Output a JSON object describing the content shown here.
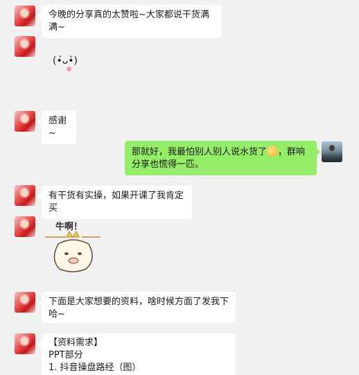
{
  "messages": {
    "m1": {
      "text": "今晚的分享真的太赞啦~大家都说干货满满~"
    },
    "m2": {
      "kaomoji": "(•́ᴗ•̀)"
    },
    "m3": {
      "text": "感谢~"
    },
    "m4": {
      "text_before": "那就好，我最怕别人别人说水货了",
      "text_after": "，群响分享也慌得一匹。",
      "emoji_icon": "laughing-face-emoji"
    },
    "m5": {
      "text": "有干货有实操，如果开课了我肯定买"
    },
    "m6": {
      "sticker_text": "牛啊！"
    },
    "m7": {
      "text": "下面是大家想要的资料，啥时候方面了发我下哈~"
    },
    "m8": {
      "lines": [
        "【资料需求】",
        "PPT部分",
        "1. 抖音操盘路经（图）"
      ]
    }
  },
  "colors": {
    "background": "#f1f1f1",
    "bubble_in": "#ffffff",
    "bubble_out": "#95ec69"
  }
}
